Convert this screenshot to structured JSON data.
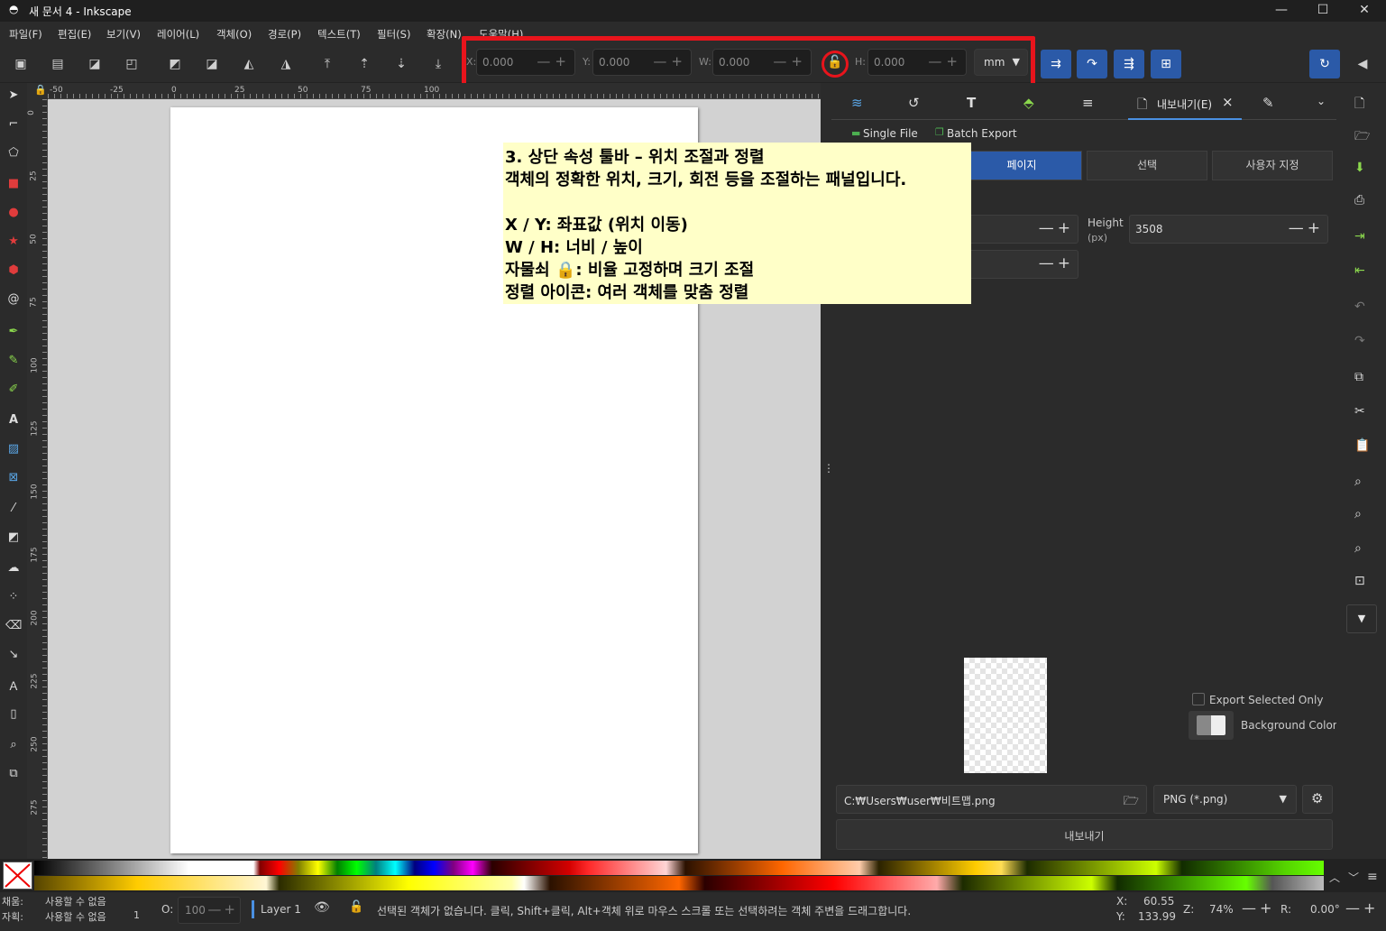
{
  "window": {
    "title": "새 문서 4 - Inkscape",
    "minimize": "—",
    "maximize": "☐",
    "close": "✕"
  },
  "menu": [
    {
      "label": "파일(F)"
    },
    {
      "label": "편집(E)"
    },
    {
      "label": "보기(V)"
    },
    {
      "label": "레이어(L)"
    },
    {
      "label": "객체(O)"
    },
    {
      "label": "경로(P)"
    },
    {
      "label": "텍스트(T)"
    },
    {
      "label": "필터(S)"
    },
    {
      "label": "확장(N)"
    },
    {
      "label": "도움말(H)"
    }
  ],
  "toolbar": {
    "x": {
      "label": "X:",
      "value": "0.000"
    },
    "y": {
      "label": "Y:",
      "value": "0.000"
    },
    "w": {
      "label": "W:",
      "value": "0.000"
    },
    "h": {
      "label": "H:",
      "value": "0.000"
    },
    "unit": "mm",
    "lock_icon": "lock-open-icon",
    "pm": "—+"
  },
  "hruler": [
    "-50",
    "-25",
    "0",
    "25",
    "50",
    "75",
    "100"
  ],
  "vruler": [
    "0",
    "25",
    "50",
    "75",
    "100",
    "125",
    "150",
    "175",
    "200",
    "225",
    "250",
    "275"
  ],
  "annotation": {
    "line1": "3. 상단 속성 툴바 – 위치 조절과 정렬",
    "line2": "객체의 정확한 위치, 크기, 회전 등을 조절하는 패널입니다.",
    "line3": "X / Y: 좌표값 (위치 이동)",
    "line4": "W / H: 너비 / 높이",
    "line5": "자물쇠 🔒: 비율 고정하며 크기 조절",
    "line6": "정렬 아이콘: 여러 객체를 맞춤 정렬"
  },
  "dock": {
    "export_tab": "내보내기(E)",
    "close": "×",
    "single_file": "Single File",
    "batch_export": "Batch Export",
    "seg_page": "페이지",
    "seg_select": "선택",
    "seg_custom": "사용자 지정",
    "height_label": "Height",
    "height_unit": "(px)",
    "height_value": "3508",
    "export_selected_only": "Export Selected Only",
    "background_color": "Background Color",
    "filename": "C:₩Users₩user₩비트맵.png",
    "format": "PNG (*.png)",
    "export_button": "내보내기"
  },
  "status": {
    "fill_label": "채움:",
    "stroke_label": "자획:",
    "fill_value": "사용할 수 없음",
    "stroke_value": "사용할 수 없음",
    "stroke_width": "1",
    "opacity_label": "O:",
    "opacity_value": "100",
    "layer": "Layer 1",
    "message": "선택된 객체가 없습니다. 클릭, Shift+클릭, Alt+객체 위로 마우스 스크롤 또는 선택하려는 객체 주변을 드래그합니다.",
    "x_label": "X:",
    "x_value": "60.55",
    "y_label": "Y:",
    "y_value": "133.99",
    "zoom_label": "Z:",
    "zoom_value": "74%",
    "rot_label": "R:",
    "rot_value": "0.00°"
  },
  "colors": {
    "accent": "#2b5aa8",
    "highlight": "#e8141c",
    "note_bg": "#ffffc8"
  }
}
